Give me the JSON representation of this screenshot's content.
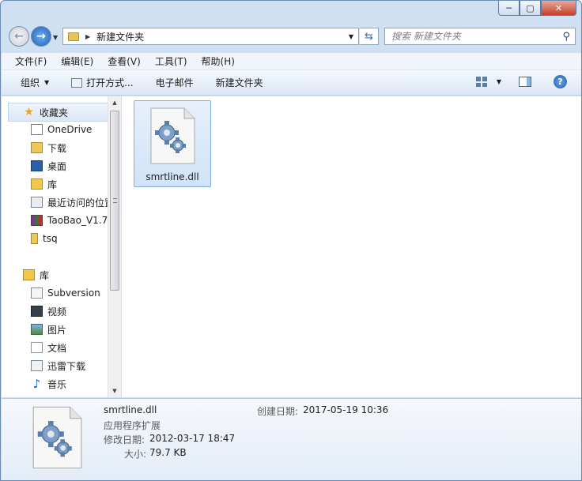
{
  "window": {
    "caption_min": "─",
    "caption_max": "▢",
    "caption_close": "✕"
  },
  "address": {
    "path": "新建文件夹",
    "search_placeholder": "搜索 新建文件夹"
  },
  "menu": [
    "文件(F)",
    "编辑(E)",
    "查看(V)",
    "工具(T)",
    "帮助(H)"
  ],
  "toolbar": {
    "organize": "组织",
    "open_with": "打开方式...",
    "email": "电子邮件",
    "new_folder": "新建文件夹"
  },
  "nav": {
    "favorites_header": "收藏夹",
    "favorites": [
      "OneDrive",
      "下载",
      "桌面",
      "库",
      "最近访问的位置",
      "TaoBao_V1.7",
      "tsq"
    ],
    "libraries_header": "库",
    "libraries": [
      "Subversion",
      "视频",
      "图片",
      "文档",
      "迅雷下载",
      "音乐"
    ]
  },
  "content": {
    "file_name": "smrtline.dll"
  },
  "details": {
    "file_name": "smrtline.dll",
    "file_type": "应用程序扩展",
    "modified_label": "修改日期:",
    "modified_value": "2012-03-17 18:47",
    "size_label": "大小:",
    "size_value": "79.7 KB",
    "created_label": "创建日期:",
    "created_value": "2017-05-19 10:36"
  },
  "colors": {
    "frame": "#cfe0f3",
    "selection": "#d0e3f8",
    "selection_border": "#84acdd",
    "close_button": "#c4402a"
  },
  "icons": {
    "back": "back-arrow-icon",
    "forward": "forward-arrow-icon",
    "refresh": "refresh-icon",
    "search": "search-icon",
    "help": "help-icon",
    "file": "dll-gear-file-icon"
  }
}
